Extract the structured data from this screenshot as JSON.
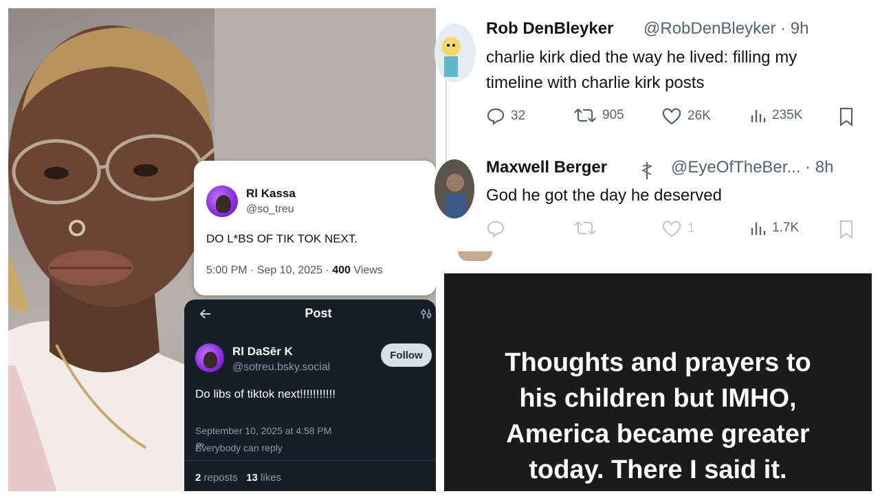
{
  "left_card_white": {
    "name": "Rl Kassa",
    "handle": "@so_treu",
    "text": "DO L*BS OF TIK TOK NEXT.",
    "time_date": "5:00 PM · Sep 10, 2025 · ",
    "views_count": "400",
    "views_label": " Views"
  },
  "left_card_dark": {
    "back_icon": "arrow-left-icon",
    "title": "Post",
    "settings_icon": "settings-icon",
    "name": "Rl DaSēr K",
    "handle": "@sotreu.bsky.social",
    "follow_label": "Follow",
    "text": "Do libs of tiktok next!!!!!!!!!!!",
    "date": "September 10, 2025 at 4:58 PM",
    "reply_setting": "Everybody can reply",
    "reposts_count": "2",
    "reposts_label": " reposts",
    "likes_count": "13",
    "likes_label": " likes",
    "background_color": "#161e27"
  },
  "tweets": [
    {
      "name": "Rob DenBleyker",
      "handle_time": "@RobDenBleyker · 9h",
      "text_line1": "charlie kirk died the way he lived: filling my",
      "text_line2": "timeline with charlie kirk posts",
      "replies": "32",
      "reposts": "905",
      "likes": "26K",
      "views": "235K"
    },
    {
      "name": "Maxwell Berger",
      "badge_icon": "caduceus-icon",
      "handle_time": "@EyeOfTheBer... · 8h",
      "text": "God he got the day he deserved",
      "replies": "",
      "reposts": "",
      "likes": "1",
      "views": "1.7K"
    }
  ],
  "black_panel": {
    "line1": "Thoughts and prayers to",
    "line2": "his children but IMHO,",
    "line3": "America became greater",
    "line4": "today. There I said it."
  }
}
